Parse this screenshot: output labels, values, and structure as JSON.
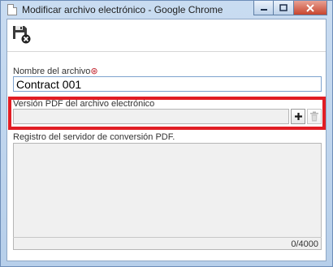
{
  "window": {
    "title": "Modificar archivo electrónico - Google Chrome",
    "minimize_glyph": "—",
    "maximize_glyph": "☐",
    "close_glyph": "✕"
  },
  "toolbar": {
    "save_icon": "save-close-icon"
  },
  "form": {
    "file_name_label": "Nombre del archivo",
    "required_mark": "⊛",
    "file_name_value": "Contract 001",
    "pdf_version_label": "Versión PDF del archivo electrónico",
    "pdf_version_value": "",
    "add_icon": "plus-icon",
    "delete_icon": "trash-icon",
    "log_label": "Registro del servidor de conversión PDF.",
    "log_value": "",
    "log_counter": "0/4000"
  },
  "colors": {
    "highlight": "#e11d24",
    "title_bar": "#c9dcf1",
    "close_button": "#c7452e",
    "required": "#c0212b"
  }
}
